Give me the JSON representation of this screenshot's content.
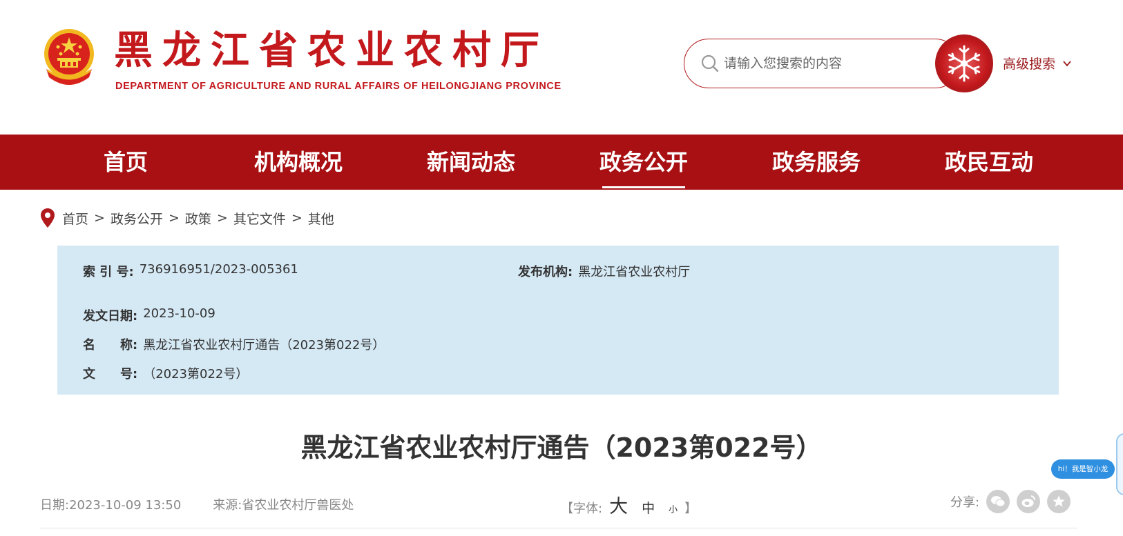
{
  "header": {
    "title": "黑龙江省农业农村厅",
    "subtitle": "DEPARTMENT OF AGRICULTURE AND RURAL AFFAIRS OF HEILONGJIANG PROVINCE",
    "search_placeholder": "请输入您搜索的内容",
    "advanced_search_label": "高级搜索"
  },
  "nav": {
    "items": [
      {
        "label": "首页"
      },
      {
        "label": "机构概况"
      },
      {
        "label": "新闻动态"
      },
      {
        "label": "政务公开",
        "active": true
      },
      {
        "label": "政务服务"
      },
      {
        "label": "政民互动"
      }
    ]
  },
  "breadcrumb": {
    "items": [
      "首页",
      "政务公开",
      "政策",
      "其它文件",
      "其他"
    ],
    "separator": ">"
  },
  "info": {
    "index_label": "索 引 号:",
    "index_value": "736916951/2023-005361",
    "publisher_label": "发布机构:",
    "publisher_value": "黑龙江省农业农村厅",
    "date_label": "发文日期:",
    "date_value": "2023-10-09",
    "name_label": "名　　称:",
    "name_value": "黑龙江省农业农村厅通告（2023第022号）",
    "doc_label": "文　　号:",
    "doc_value": "（2023第022号）"
  },
  "article": {
    "title": "黑龙江省农业农村厅通告（2023第022号）",
    "date_label": "日期:",
    "date_value": "2023-10-09 13:50",
    "source_label": "来源:",
    "source_value": "省农业农村厅兽医处",
    "font_open": "【字体:",
    "font_big": "大",
    "font_mid": "中",
    "font_small": "小",
    "font_close": "】",
    "share_label": "分享:"
  },
  "assistant": {
    "label": "hi！我是智小龙"
  },
  "colors": {
    "brand_red": "#c3191d",
    "nav_red": "#a81013",
    "info_bg": "#d5e9f5"
  },
  "icons": [
    "emblem-icon",
    "search-icon",
    "snowflake-icon",
    "chevron-down-icon",
    "location-pin-icon",
    "wechat-icon",
    "weibo-icon",
    "star-icon"
  ]
}
